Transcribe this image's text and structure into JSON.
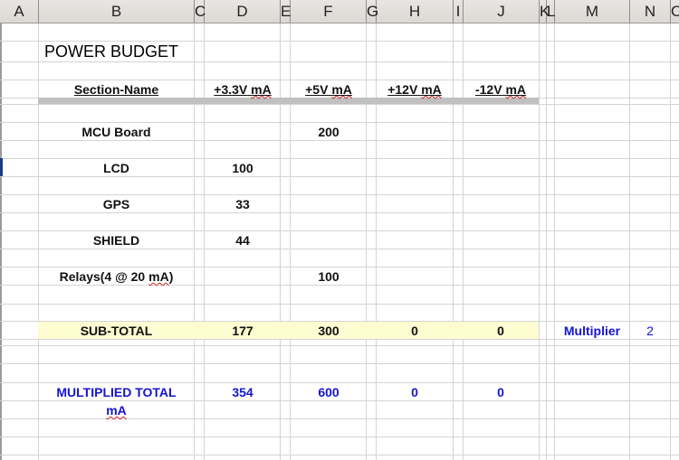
{
  "columns": [
    "A",
    "B",
    "C",
    "D",
    "E",
    "F",
    "G",
    "H",
    "I",
    "J",
    "K",
    "L",
    "M",
    "N",
    "O"
  ],
  "title": "POWER BUDGET",
  "headers": {
    "section": "Section-Name",
    "v33": "+3.3V",
    "v5": "+5V",
    "v12p": "+12V",
    "v12n": "-12V",
    "unit": "mA"
  },
  "rows": [
    {
      "name": "MCU Board",
      "v33": "",
      "v5": "200",
      "v12p": "",
      "v12n": ""
    },
    {
      "name": "LCD",
      "v33": "100",
      "v5": "",
      "v12p": "",
      "v12n": ""
    },
    {
      "name": "GPS",
      "v33": "33",
      "v5": "",
      "v12p": "",
      "v12n": ""
    },
    {
      "name": "SHIELD",
      "v33": "44",
      "v5": "",
      "v12p": "",
      "v12n": ""
    },
    {
      "name_prefix": "Relays(4 @ 20 ",
      "name_unit": "mA",
      "name_suffix": ")",
      "v33": "",
      "v5": "100",
      "v12p": "",
      "v12n": ""
    }
  ],
  "subtotal": {
    "label": "SUB-TOTAL",
    "v33": "177",
    "v5": "300",
    "v12p": "0",
    "v12n": "0"
  },
  "multiplier": {
    "label": "Multiplier",
    "value": "2"
  },
  "multiplied_total": {
    "label_line1": "MULTIPLIED TOTAL",
    "label_line2": "mA",
    "v33": "354",
    "v5": "600",
    "v12p": "0",
    "v12n": "0"
  },
  "colors": {
    "accent_blue": "#1414d2",
    "subtotal_bg": "#fefcd1",
    "separator": "#c0c0c0"
  }
}
